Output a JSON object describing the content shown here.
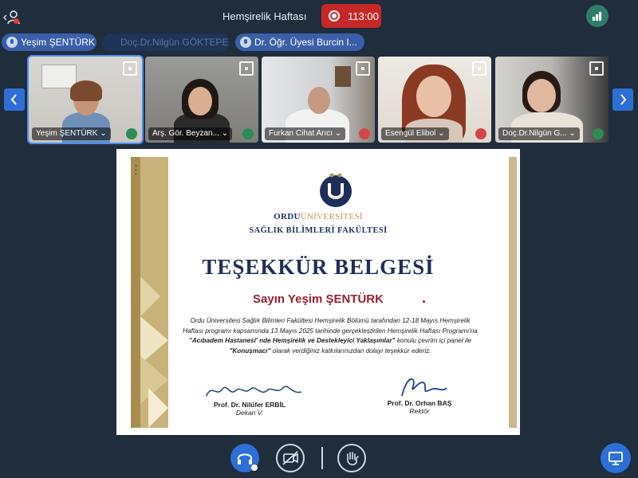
{
  "topbar": {
    "meeting_title": "Hemşirelik Haftası",
    "recording_timer": "113:00"
  },
  "presenters": [
    {
      "label": "Yeşim ŞENTÜRK"
    },
    {
      "label": "Doç.Dr.Nilgün GÖKTEPE"
    },
    {
      "label": "Dr. Öğr. Üyesi Burcin I..."
    }
  ],
  "participants": [
    {
      "name": "Yeşim ŞENTÜRK"
    },
    {
      "name": "Arş. Gör. Beyzan..."
    },
    {
      "name": "Furkan Cihat Arıcı"
    },
    {
      "name": "Esengül Elibol"
    },
    {
      "name": "Doç.Dr.Nilgün G..."
    }
  ],
  "certificate": {
    "university_main": "ORDU",
    "university_suffix": "ÜNİVERSİTESİ",
    "faculty": "SAĞLIK BİLİMLERİ FAKÜLTESİ",
    "headline": "TEŞEKKÜR BELGESİ",
    "recipient": "Sayın Yeşim ŞENTÜRK",
    "body_1": "Ordu Üniversitesi Sağlık Bilimleri Fakültesi Hemşirelik Bölümü tarafından 12-18 Mayıs Hemşirelik Haftası programı kapsamında 13 Mayıs 2025 tarihinde gerçekleştirilen Hemşirelik Haftası Programı'na ",
    "body_bold_1": "\"Acıbadem Hastanesi' nde Hemşirelik ve Destekleyici Yaklaşımlar\"",
    "body_2": " konulu çevrim içi panel ile ",
    "body_bold_2": "\"Konuşmacı\"",
    "body_3": " olarak verdiğiniz katkılarınızdan dolayı teşekkür ederiz.",
    "signer_left_name": "Prof. Dr. Nilüfer ERBİL",
    "signer_left_title": "Dekan V.",
    "signer_right_name": "Prof. Dr. Orhan BAŞ",
    "signer_right_title": "Rektör"
  },
  "colors": {
    "background": "#1f2d3d",
    "accent": "#2d6fd6",
    "record": "#c62828",
    "cert_navy": "#1f2f5a",
    "cert_gold": "#b59a55",
    "cert_red": "#9a1f2a"
  }
}
